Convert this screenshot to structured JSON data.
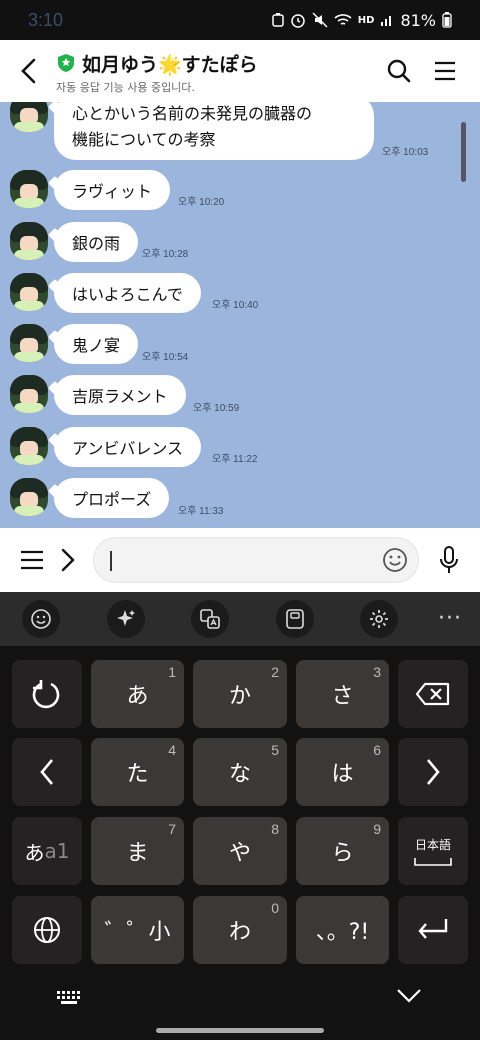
{
  "status_bar": {
    "time": "3:10",
    "battery": "81%",
    "network_badge": "HD"
  },
  "header": {
    "title": "如月ゆう🌟すたぽら",
    "subtitle": "자동 응답 기능 사용 중입니다."
  },
  "messages": [
    {
      "text_lines": [
        "心とかいう名前の未発見の臓器の",
        "機能についての考察"
      ],
      "time": "오후 10:03"
    },
    {
      "text": "ラヴィット",
      "time": "오후 10:20"
    },
    {
      "text": "銀の雨",
      "time": "오후 10:28"
    },
    {
      "text": "はいよろこんで",
      "time": "오후 10:40"
    },
    {
      "text": "鬼ノ宴",
      "time": "오후 10:54"
    },
    {
      "text": "吉原ラメント",
      "time": "오후 10:59"
    },
    {
      "text": "アンビバレンス",
      "time": "오후 11:22"
    },
    {
      "text": "プロポーズ",
      "time": "오후 11:33"
    }
  ],
  "input": {
    "value": "",
    "placeholder": ""
  },
  "keyboard": {
    "toolbar": [
      "emoji-icon",
      "sparkle-icon",
      "translate-icon",
      "clipboard-icon",
      "settings-icon"
    ],
    "more_label": "···",
    "keys": {
      "k1": {
        "label": "あ",
        "num": "1"
      },
      "k2": {
        "label": "か",
        "num": "2"
      },
      "k3": {
        "label": "さ",
        "num": "3"
      },
      "k4": {
        "label": "た",
        "num": "4"
      },
      "k5": {
        "label": "な",
        "num": "5"
      },
      "k6": {
        "label": "は",
        "num": "6"
      },
      "k7": {
        "label": "ま",
        "num": "7"
      },
      "k8": {
        "label": "や",
        "num": "8"
      },
      "k9": {
        "label": "ら",
        "num": "9"
      },
      "k0": {
        "label": "わ",
        "num": "0"
      },
      "small": {
        "label": "゛゜小"
      },
      "punct": {
        "label": "、。?!"
      },
      "mode": {
        "label_a": "あ",
        "label_b": "a1"
      },
      "lang": {
        "label": "日本語"
      }
    },
    "colors": {
      "key": "#3b3836",
      "key_dark": "#242222",
      "bg": "#121212"
    }
  },
  "colors": {
    "chat_bg": "#9bb5dc",
    "bubble": "#ffffff",
    "shield": "#22b14c"
  }
}
